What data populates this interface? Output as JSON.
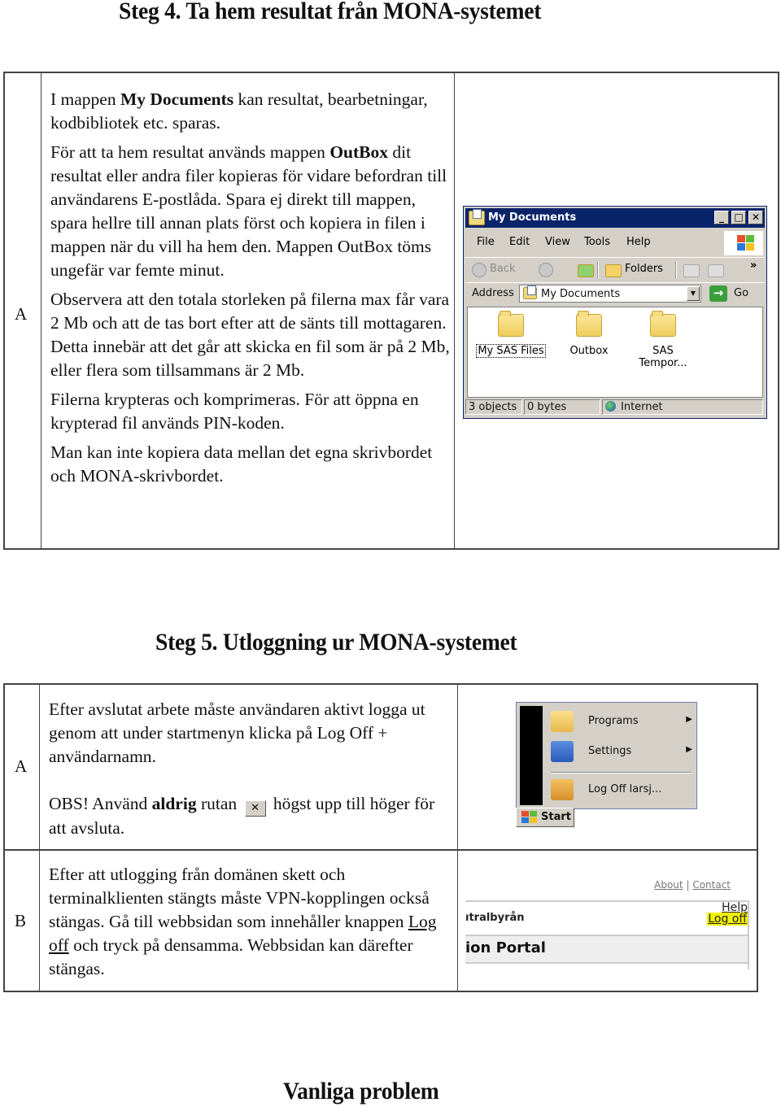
{
  "headings": {
    "steg4": "Steg 4. Ta hem resultat från MONA-systemet",
    "steg5": "Steg 5. Utloggning ur MONA-systemet",
    "vanliga": "Vanliga problem"
  },
  "steg4": {
    "row_label": "A",
    "paragraphs": {
      "p1_pre": "I mappen ",
      "p1_bold": "My Documents",
      "p1_post": " kan resultat, bearbetningar, kodbibliotek etc. sparas.",
      "p2_pre": "För att ta hem resultat används mappen ",
      "p2_bold": "OutBox",
      "p2_post": " dit resultat eller andra filer kopieras för vidare befordran till användarens E-postlåda. Spara ej direkt till mappen, spara hellre till annan plats först och kopiera in filen i mappen när du vill ha hem den. Mappen OutBox töms ungefär var femte minut.",
      "p3": "Observera att den totala storleken på filerna max får vara 2 Mb och att de tas bort efter att de sänts till mottagaren. Detta innebär att det går att skicka en fil som är på 2 Mb, eller flera som tillsammans är 2 Mb.",
      "p4": "Filerna krypteras och komprimeras. För att öppna en krypterad fil används PIN-koden.",
      "p5": "Man kan inte kopiera data mellan det egna skrivbordet och MONA-skrivbordet."
    },
    "explorer": {
      "title": "My Documents",
      "controls": {
        "minimize": "_",
        "maximize": "□",
        "close": "✕"
      },
      "menu": [
        "File",
        "Edit",
        "View",
        "Tools",
        "Help"
      ],
      "toolbar": {
        "back": "Back",
        "folders": "Folders",
        "more": "»"
      },
      "address_label": "Address",
      "address_value": "My Documents",
      "go_label": "Go",
      "folders": [
        "My SAS Files",
        "Outbox",
        "SAS Tempor..."
      ],
      "status": {
        "objects": "3 objects",
        "size": "0 bytes",
        "zone": "Internet"
      }
    }
  },
  "steg5": {
    "rowA": {
      "label": "A",
      "p1": "Efter avslutat arbete måste användaren aktivt logga ut genom att under startmenyn klicka på Log Off + användarnamn.",
      "p2_pre": "OBS! Använd ",
      "p2_bold": "aldrig",
      "p2_mid": " rutan",
      "p2_post": " högst upp till höger för att avsluta.",
      "close_glyph": "✕",
      "startmenu": {
        "items": [
          "Programs",
          "Settings",
          "Log Off larsj..."
        ],
        "arrow": "▶",
        "start_label": "Start"
      }
    },
    "rowB": {
      "label": "B",
      "p_pre": "Efter att utlogging från domänen skett och terminalklienten stängts måste VPN-kopplingen också stängas. Gå till webbsidan som innehåller knappen ",
      "p_link": "Log off",
      "p_post": " och tryck på densamma. Webbsidan kan därefter stängas.",
      "portal": {
        "about": "About",
        "sep": "|",
        "contact": "Contact",
        "org": "ıtralbyrån",
        "help": "Help",
        "logoff": "Log off",
        "title": "ion Portal",
        "highlight_color": "#f2f200"
      }
    }
  }
}
